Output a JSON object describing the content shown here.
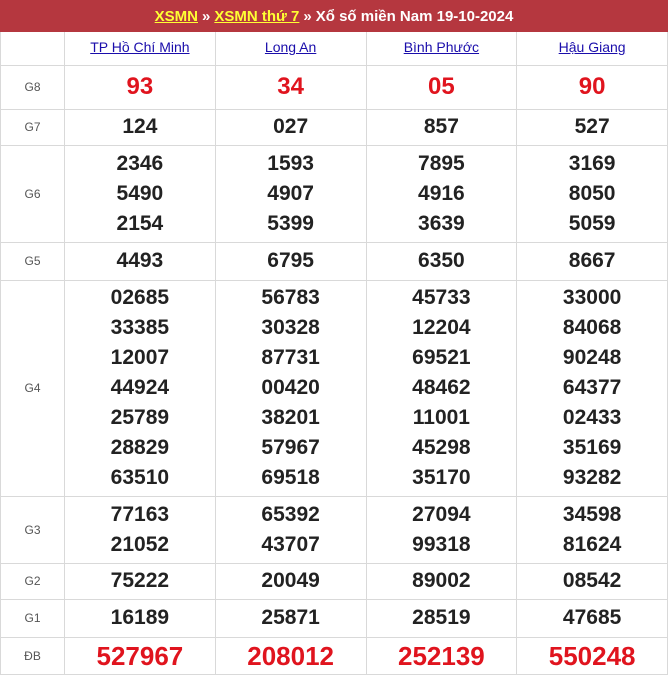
{
  "header": {
    "link1": "XSMN",
    "sep1": "»",
    "link2": "XSMN thứ 7",
    "sep2": "»",
    "title": "Xổ số miền Nam 19-10-2024",
    "bg_color": "#b5373f",
    "link_color": "#ffff33"
  },
  "provinces": [
    "TP Hồ Chí Minh",
    "Long An",
    "Bình Phước",
    "Hậu Giang"
  ],
  "prizes": [
    {
      "label": "G8",
      "values": [
        [
          "93"
        ],
        [
          "34"
        ],
        [
          "05"
        ],
        [
          "90"
        ]
      ]
    },
    {
      "label": "G7",
      "values": [
        [
          "124"
        ],
        [
          "027"
        ],
        [
          "857"
        ],
        [
          "527"
        ]
      ]
    },
    {
      "label": "G6",
      "values": [
        [
          "2346",
          "5490",
          "2154"
        ],
        [
          "1593",
          "4907",
          "5399"
        ],
        [
          "7895",
          "4916",
          "3639"
        ],
        [
          "3169",
          "8050",
          "5059"
        ]
      ]
    },
    {
      "label": "G5",
      "values": [
        [
          "4493"
        ],
        [
          "6795"
        ],
        [
          "6350"
        ],
        [
          "8667"
        ]
      ]
    },
    {
      "label": "G4",
      "values": [
        [
          "02685",
          "33385",
          "12007",
          "44924",
          "25789",
          "28829",
          "63510"
        ],
        [
          "56783",
          "30328",
          "87731",
          "00420",
          "38201",
          "57967",
          "69518"
        ],
        [
          "45733",
          "12204",
          "69521",
          "48462",
          "11001",
          "45298",
          "35170"
        ],
        [
          "33000",
          "84068",
          "90248",
          "64377",
          "02433",
          "35169",
          "93282"
        ]
      ]
    },
    {
      "label": "G3",
      "values": [
        [
          "77163",
          "21052"
        ],
        [
          "65392",
          "43707"
        ],
        [
          "27094",
          "99318"
        ],
        [
          "34598",
          "81624"
        ]
      ]
    },
    {
      "label": "G2",
      "values": [
        [
          "75222"
        ],
        [
          "20049"
        ],
        [
          "89002"
        ],
        [
          "08542"
        ]
      ]
    },
    {
      "label": "G1",
      "values": [
        [
          "16189"
        ],
        [
          "25871"
        ],
        [
          "28519"
        ],
        [
          "47685"
        ]
      ]
    },
    {
      "label": "ĐB",
      "values": [
        [
          "527967"
        ],
        [
          "208012"
        ],
        [
          "252139"
        ],
        [
          "550248"
        ]
      ]
    }
  ],
  "colors": {
    "special": "#e0141e",
    "link": "#1a0dab"
  }
}
